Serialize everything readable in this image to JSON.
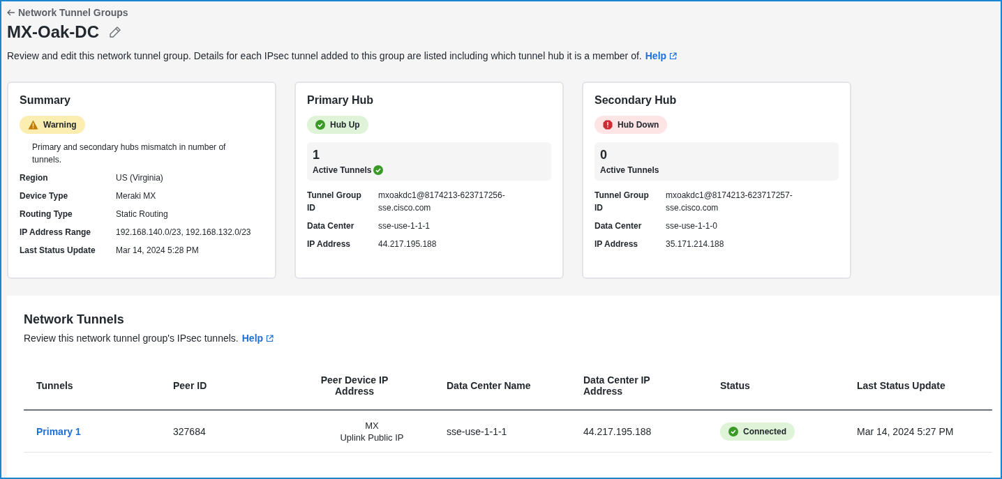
{
  "breadcrumb": {
    "label": "Network Tunnel Groups"
  },
  "title": "MX-Oak-DC",
  "description": "Review and edit this network tunnel group. Details for each IPsec tunnel added to this group are listed including which tunnel hub it is a member of.",
  "description_link": "Help",
  "summary": {
    "title": "Summary",
    "badge": {
      "label": "Warning",
      "kind": "warning"
    },
    "message": "Primary and secondary hubs mismatch in number of tunnels.",
    "fields": [
      {
        "label": "Region",
        "value": "US (Virginia)"
      },
      {
        "label": "Device Type",
        "value": "Meraki MX"
      },
      {
        "label": "Routing Type",
        "value": "Static Routing"
      },
      {
        "label": "IP Address Range",
        "value": "192.168.140.0/23, 192.168.132.0/23"
      },
      {
        "label": "Last Status Update",
        "value": "Mar 14, 2024 5:28 PM"
      }
    ]
  },
  "hubs": [
    {
      "title": "Primary Hub",
      "badge": {
        "label": "Hub Up",
        "kind": "success"
      },
      "count": "1",
      "count_label": "Active Tunnels",
      "verified": true,
      "fields": [
        {
          "label": "Tunnel Group ID",
          "value": "mxoakdc1@8174213-623717256-sse.cisco.com"
        },
        {
          "label": "Data Center",
          "value": "sse-use-1-1-1"
        },
        {
          "label": "IP Address",
          "value": "44.217.195.188"
        }
      ]
    },
    {
      "title": "Secondary Hub",
      "badge": {
        "label": "Hub Down",
        "kind": "error"
      },
      "count": "0",
      "count_label": "Active Tunnels",
      "verified": false,
      "fields": [
        {
          "label": "Tunnel Group ID",
          "value": "mxoakdc1@8174213-623717257-sse.cisco.com"
        },
        {
          "label": "Data Center",
          "value": "sse-use-1-1-0"
        },
        {
          "label": "IP Address",
          "value": "35.171.214.188"
        }
      ]
    }
  ],
  "tunnels": {
    "title": "Network Tunnels",
    "description": "Review this network tunnel group's IPsec tunnels.",
    "description_link": "Help",
    "table": {
      "columns": [
        "Tunnels",
        "Peer ID",
        "Peer Device IP Address",
        "Data Center Name",
        "Data Center IP Address",
        "Status",
        "Last Status Update"
      ],
      "rows": [
        {
          "tunnel": "Primary 1",
          "peer_id": "327684",
          "peer_device_ip": [
            "MX",
            "Uplink Public IP"
          ],
          "data_center_name": "sse-use-1-1-1",
          "data_center_ip": "44.217.195.188",
          "status": {
            "label": "Connected",
            "kind": "success"
          },
          "last_status_update": "Mar 14, 2024 5:27 PM"
        }
      ]
    }
  }
}
